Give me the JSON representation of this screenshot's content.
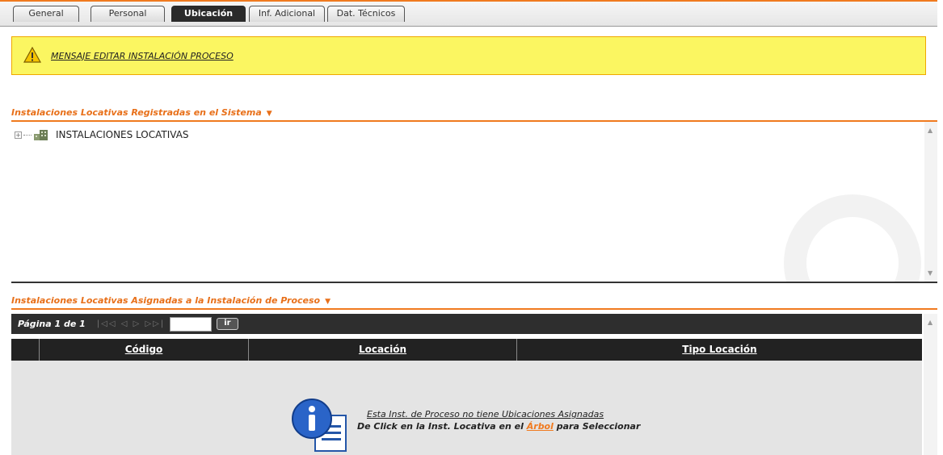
{
  "tabs": [
    {
      "label": "General",
      "active": false
    },
    {
      "label": "Personal",
      "active": false
    },
    {
      "label": "Ubicación",
      "active": true
    },
    {
      "label": "Inf. Adicional",
      "active": false
    },
    {
      "label": "Dat. Técnicos",
      "active": false
    }
  ],
  "warning": {
    "icon": "warning-icon",
    "message": "MENSAJE EDITAR INSTALACIÓN PROCESO",
    "background": "#fbf661"
  },
  "tree_section": {
    "title": "Instalaciones Locativas Registradas en el Sistema",
    "root_label": "INSTALACIONES LOCATIVAS",
    "root_icon": "building-icon"
  },
  "assigned_section": {
    "title": "Instalaciones Locativas Asignadas a la Instalación de Proceso",
    "pager": {
      "page_text": "Página 1 de 1",
      "page_input_value": "",
      "go_label": "ir"
    },
    "columns": [
      "",
      "Código",
      "Locación",
      "Tipo Locación"
    ],
    "rows": [],
    "empty_message_line1": "Esta Inst. de Proceso no tiene Ubicaciones Asignadas",
    "empty_message_line2_prefix": "De Click en la Inst. Locativa en el",
    "empty_message_line2_link": "Árbol",
    "empty_message_line2_suffix": "para Seleccionar",
    "empty_icon": "info-icon"
  },
  "colors": {
    "accent": "#f07a1f",
    "header_dark": "#222222",
    "grid_body": "#e4e4e4"
  }
}
